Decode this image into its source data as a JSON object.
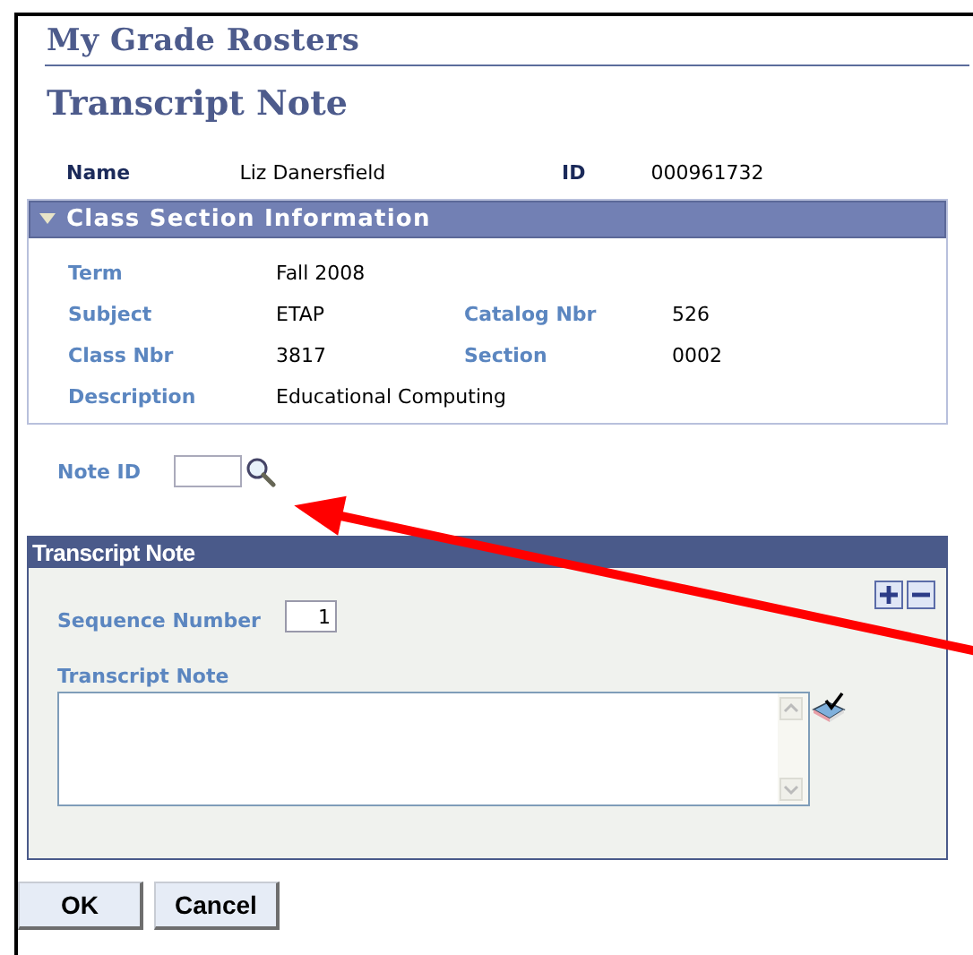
{
  "breadcrumb_title": "My Grade Rosters",
  "page_title": "Transcript Note",
  "student": {
    "name_label": "Name",
    "name": "Liz Danersfield",
    "id_label": "ID",
    "id": "000961732"
  },
  "class_section": {
    "title": "Class Section Information",
    "expanded": true,
    "rows": [
      {
        "fields": [
          {
            "label": "Term",
            "value": "Fall 2008"
          }
        ]
      },
      {
        "fields": [
          {
            "label": "Subject",
            "value": "ETAP"
          },
          {
            "label": "Catalog Nbr",
            "value": "526"
          }
        ]
      },
      {
        "fields": [
          {
            "label": "Class Nbr",
            "value": "3817"
          },
          {
            "label": "Section",
            "value": "0002"
          }
        ]
      },
      {
        "fields": [
          {
            "label": "Description",
            "value": "Educational Computing"
          }
        ]
      }
    ]
  },
  "note_id": {
    "label": "Note ID"
  },
  "transcript_note": {
    "title": "Transcript Note",
    "sequence_label": "Sequence Number",
    "sequence_value": "1",
    "note_label": "Transcript Note"
  },
  "buttons": [
    "OK",
    "Cancel"
  ]
}
